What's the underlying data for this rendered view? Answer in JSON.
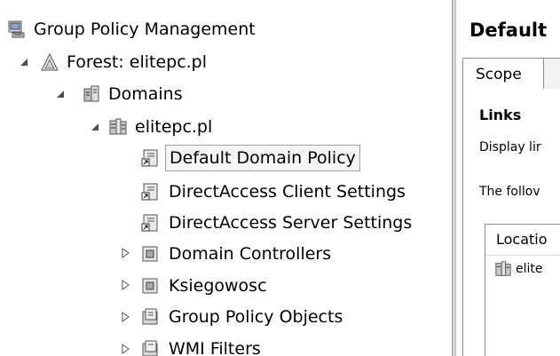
{
  "tree": {
    "root": {
      "label": "Group Policy Management",
      "icon": "gpmc-console-icon"
    },
    "forest": {
      "label": "Forest: elitepc.pl",
      "icon": "forest-triangle-icon"
    },
    "domains": {
      "label": "Domains",
      "icon": "domains-icon"
    },
    "domain": {
      "label": "elitepc.pl",
      "icon": "domain-icon"
    },
    "items": [
      {
        "label": "Default Domain Policy",
        "icon": "gpo-link-icon",
        "selected": true
      },
      {
        "label": "DirectAccess Client Settings",
        "icon": "gpo-link-icon"
      },
      {
        "label": "DirectAccess Server Settings",
        "icon": "gpo-link-icon"
      },
      {
        "label": "Domain Controllers",
        "icon": "ou-icon"
      },
      {
        "label": "Ksiegowosc",
        "icon": "ou-icon"
      },
      {
        "label": "Group Policy Objects",
        "icon": "gpo-folder-icon"
      },
      {
        "label": "WMI Filters",
        "icon": "wmi-folder-icon"
      }
    ]
  },
  "right": {
    "title": "Default",
    "tab_scope": "Scope",
    "links_heading": "Links",
    "display_text": "Display lir",
    "following_text": "The follov",
    "column_location": "Locatio",
    "row_location": "elite"
  }
}
